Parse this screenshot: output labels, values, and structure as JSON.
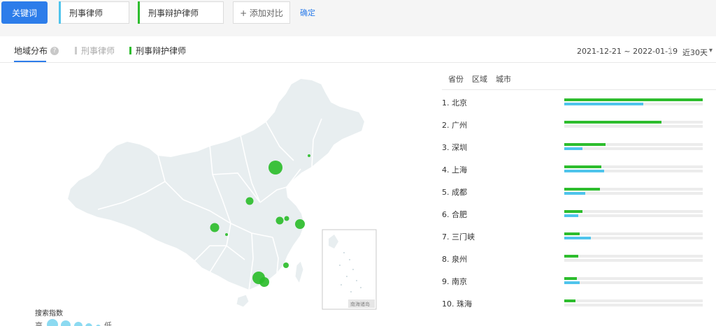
{
  "toolbar": {
    "keyword_button": "关键词",
    "keywords": [
      {
        "label": "刑事律师",
        "color": "#4fc4ec"
      },
      {
        "label": "刑事辩护律师",
        "color": "#2dbd2d"
      }
    ],
    "add_compare": "+ 添加对比",
    "confirm": "确定"
  },
  "tabs": {
    "region": "地域分布",
    "help": "?",
    "legend": [
      {
        "label": "刑事律师",
        "color": "#cccccc"
      },
      {
        "label": "刑事辩护律师",
        "color": "#2dbd2d"
      }
    ]
  },
  "date_range": "2021-12-21 ~ 2022-01-19",
  "period": "近30天",
  "period_arrow": "▾",
  "map": {
    "scale_title": "搜索指数",
    "scale_high": "高",
    "scale_low": "低",
    "inset_label": "南海诸岛"
  },
  "ranking": {
    "tabs": [
      "省份",
      "区域",
      "城市"
    ],
    "colors": {
      "primary": "#2dbd2d",
      "secondary": "#4fc4ec"
    },
    "rows": [
      {
        "label": "1.  北京",
        "green": 1.0,
        "blue": 0.57
      },
      {
        "label": "2.  广州",
        "green": 0.7,
        "blue": 0
      },
      {
        "label": "3.  深圳",
        "green": 0.3,
        "blue": 0.13
      },
      {
        "label": "4.  上海",
        "green": 0.27,
        "blue": 0.29
      },
      {
        "label": "5.  成都",
        "green": 0.26,
        "blue": 0.15
      },
      {
        "label": "6.  合肥",
        "green": 0.13,
        "blue": 0.1
      },
      {
        "label": "7.  三门峡",
        "green": 0.11,
        "blue": 0.19
      },
      {
        "label": "8.  泉州",
        "green": 0.1,
        "blue": 0
      },
      {
        "label": "9.  南京",
        "green": 0.09,
        "blue": 0.11
      },
      {
        "label": "10. 珠海",
        "green": 0.08,
        "blue": 0
      }
    ]
  }
}
